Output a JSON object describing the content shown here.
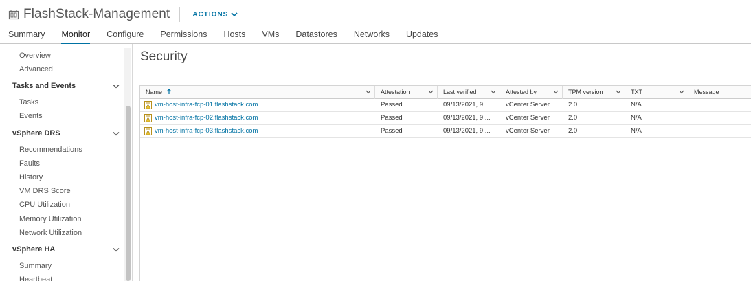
{
  "header": {
    "title": "FlashStack-Management",
    "actions_label": "ACTIONS"
  },
  "tabs": [
    {
      "label": "Summary"
    },
    {
      "label": "Monitor"
    },
    {
      "label": "Configure"
    },
    {
      "label": "Permissions"
    },
    {
      "label": "Hosts"
    },
    {
      "label": "VMs"
    },
    {
      "label": "Datastores"
    },
    {
      "label": "Networks"
    },
    {
      "label": "Updates"
    }
  ],
  "active_tab": "Monitor",
  "sidebar": {
    "overview": "Overview",
    "advanced": "Advanced",
    "tasks_events": {
      "label": "Tasks and Events",
      "items": [
        "Tasks",
        "Events"
      ]
    },
    "drs": {
      "label": "vSphere DRS",
      "items": [
        "Recommendations",
        "Faults",
        "History",
        "VM DRS Score",
        "CPU Utilization",
        "Memory Utilization",
        "Network Utilization"
      ]
    },
    "ha": {
      "label": "vSphere HA",
      "items": [
        "Summary",
        "Heartbeat"
      ]
    }
  },
  "main": {
    "page_title": "Security",
    "columns": [
      "Name",
      "Attestation",
      "Last verified",
      "Attested by",
      "TPM version",
      "TXT",
      "Message"
    ],
    "rows": [
      {
        "name": "vm-host-infra-fcp-01.flashstack.com",
        "attestation": "Passed",
        "last_verified": "09/13/2021, 9:...",
        "attested_by": "vCenter Server",
        "tpm_version": "2.0",
        "txt": "N/A",
        "message": ""
      },
      {
        "name": "vm-host-infra-fcp-02.flashstack.com",
        "attestation": "Passed",
        "last_verified": "09/13/2021, 9:...",
        "attested_by": "vCenter Server",
        "tpm_version": "2.0",
        "txt": "N/A",
        "message": ""
      },
      {
        "name": "vm-host-infra-fcp-03.flashstack.com",
        "attestation": "Passed",
        "last_verified": "09/13/2021, 9:...",
        "attested_by": "vCenter Server",
        "tpm_version": "2.0",
        "txt": "N/A",
        "message": ""
      }
    ]
  },
  "colors": {
    "accent": "#0072a3",
    "host_icon": "#c9a227"
  },
  "icons": {
    "datacenter": "datacenter-icon",
    "actions_chevron": "chevron-down-icon",
    "sort": "sort-ascending-icon",
    "host": "host-warning-icon"
  }
}
